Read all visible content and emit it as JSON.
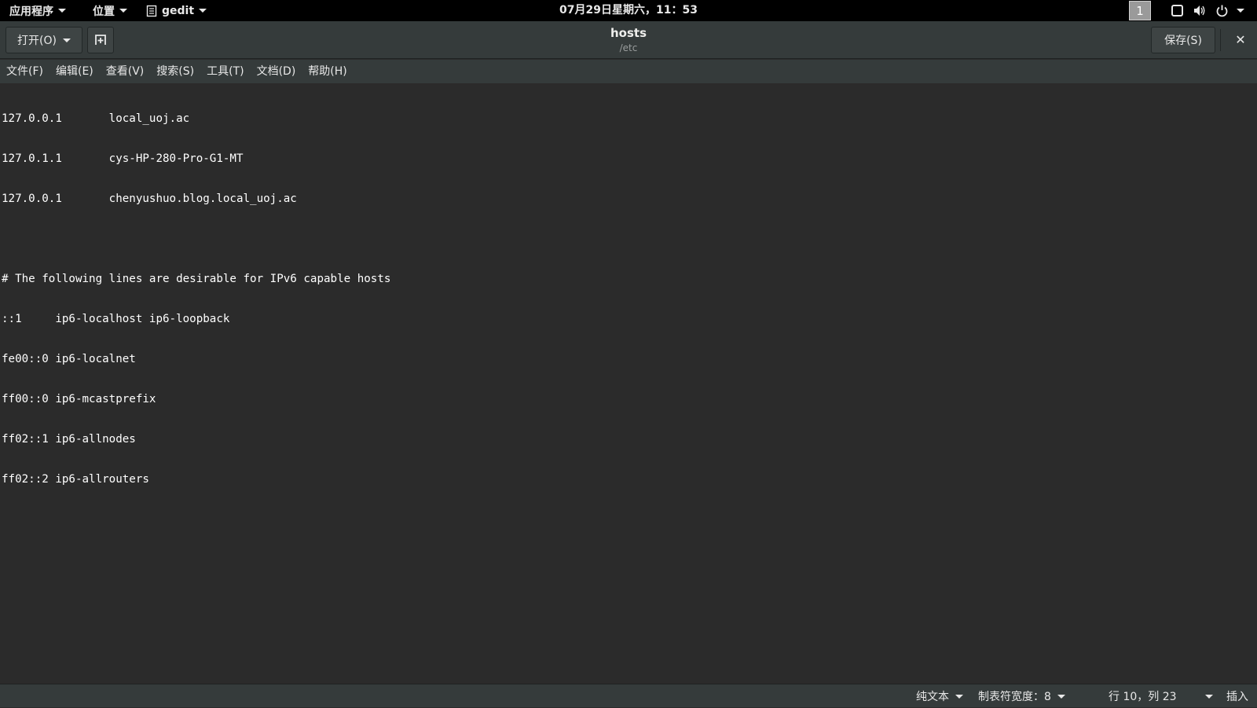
{
  "topbar": {
    "apps_label": "应用程序",
    "places_label": "位置",
    "app_name": "gedit",
    "clock": "07月29日星期六，11：53",
    "workspace": "1"
  },
  "header": {
    "open_label": "打开(O)",
    "title": "hosts",
    "subtitle": "/etc",
    "save_label": "保存(S)",
    "close_glyph": "✕"
  },
  "menu": {
    "file": "文件(F)",
    "edit": "编辑(E)",
    "view": "查看(V)",
    "search": "搜索(S)",
    "tools": "工具(T)",
    "documents": "文档(D)",
    "help": "帮助(H)"
  },
  "editor": {
    "lines": [
      "127.0.0.1       local_uoj.ac",
      "127.0.1.1       cys-HP-280-Pro-G1-MT",
      "127.0.0.1       chenyushuo.blog.local_uoj.ac",
      "",
      "# The following lines are desirable for IPv6 capable hosts",
      "::1     ip6-localhost ip6-loopback",
      "fe00::0 ip6-localnet",
      "ff00::0 ip6-mcastprefix",
      "ff02::1 ip6-allnodes",
      "ff02::2 ip6-allrouters"
    ]
  },
  "status": {
    "language": "纯文本",
    "tab_width": "制表符宽度：8",
    "position": "行 10，列 23",
    "mode": "插入"
  },
  "icons": {
    "new_tab": "new-document-icon",
    "app": "gedit-document-icon",
    "screen": "screen-icon",
    "volume": "volume-icon",
    "power": "power-icon"
  }
}
